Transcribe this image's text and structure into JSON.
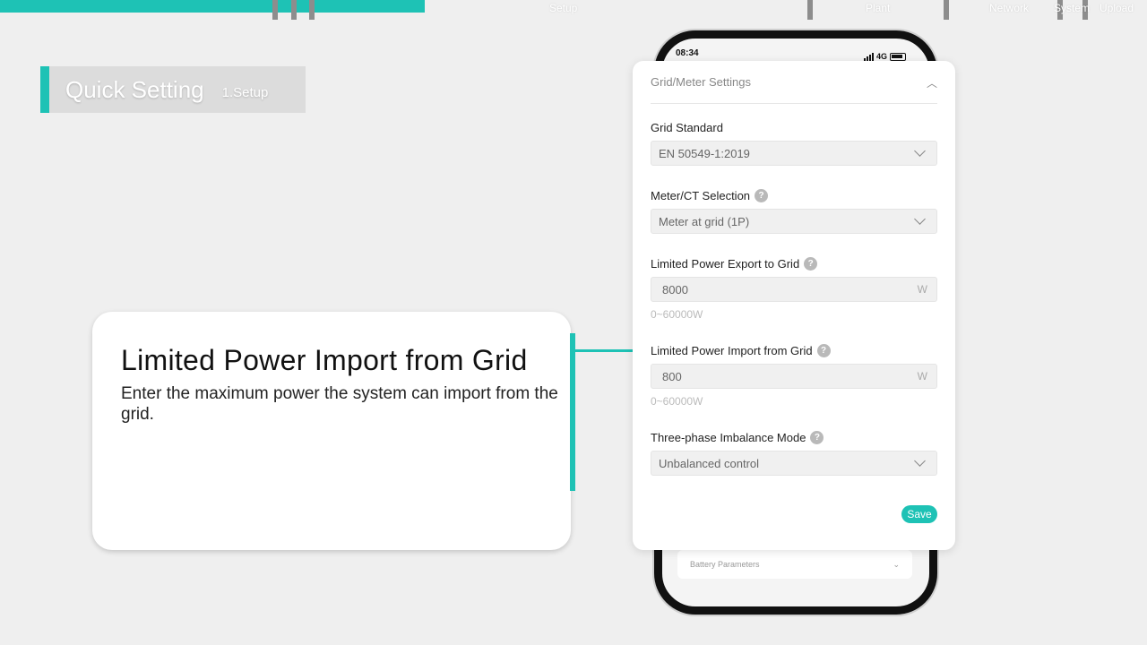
{
  "progress": {
    "fill_fraction": 0.37,
    "accent_color": "#1ec2b5",
    "steps": [
      "Setup",
      "Plant",
      "Network",
      "System",
      "Upload"
    ]
  },
  "quick_setting": {
    "title": "Quick Setting",
    "step": "1.Setup"
  },
  "callout": {
    "title": "Limited Power Import from Grid",
    "description": "Enter the maximum power the system can import from the grid."
  },
  "phone": {
    "time": "08:34",
    "network": "4G"
  },
  "panel": {
    "title": "Grid/Meter Settings",
    "collapse_icon": "chevron-up-icon",
    "grid_standard": {
      "label": "Grid Standard",
      "value": "EN 50549-1:2019"
    },
    "meter_ct": {
      "label": "Meter/CT Selection",
      "value": "Meter at grid (1P)"
    },
    "export_limit": {
      "label": "Limited Power Export to Grid",
      "value": "8000",
      "unit": "W",
      "hint": "0~60000W"
    },
    "import_limit": {
      "label": "Limited Power Import from Grid",
      "value": "800",
      "unit": "W",
      "hint": "0~60000W"
    },
    "imbalance": {
      "label": "Three-phase Imbalance Mode",
      "value": "Unbalanced control"
    },
    "save_label": "Save"
  },
  "battery_parameters": {
    "label": "Battery Parameters"
  }
}
